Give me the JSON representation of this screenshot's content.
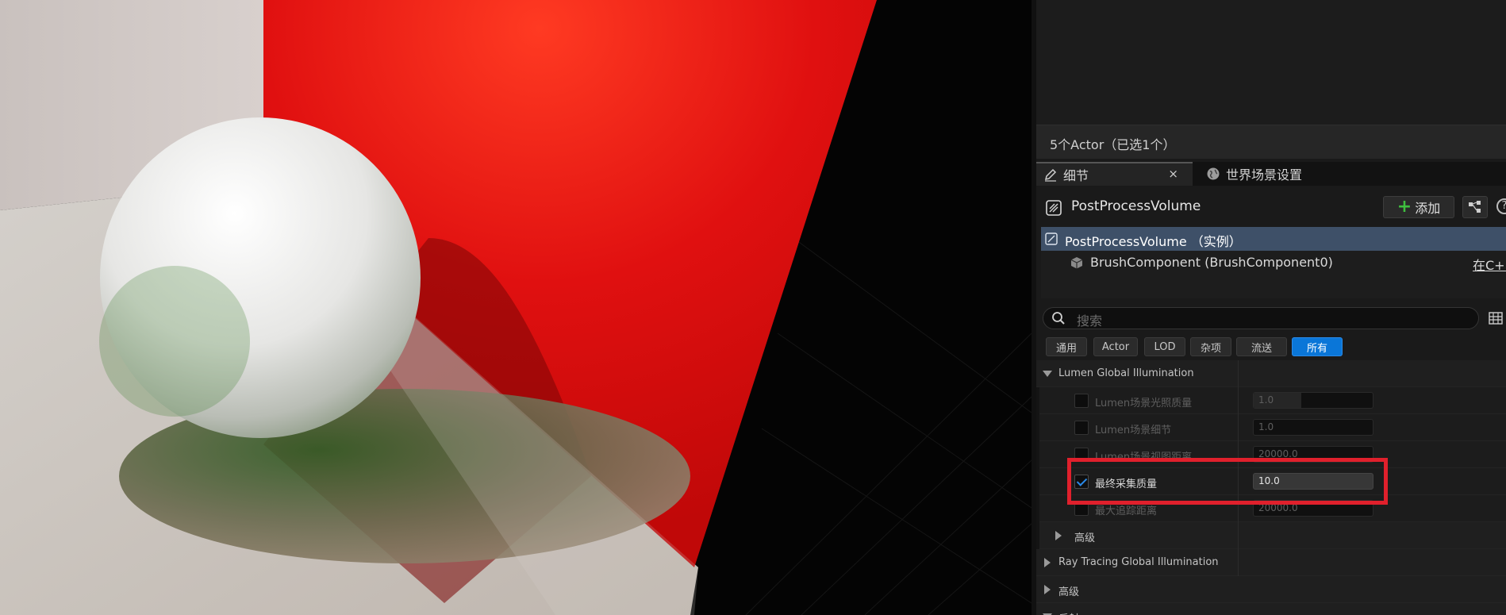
{
  "outliner": {
    "actor_count": "5个Actor（已选1个）"
  },
  "tabs": [
    {
      "label": "细节",
      "icon": "pencil-icon",
      "close": "×"
    },
    {
      "label": "世界场景设置",
      "icon": "globe-icon"
    }
  ],
  "details_header": {
    "title": "PostProcessVolume",
    "add_label": "添加",
    "add_icon": "plus-icon",
    "blueprint_icon": "blueprint-icon",
    "help_icon": "help-icon"
  },
  "components": [
    {
      "label": "PostProcessVolume （实例）",
      "selected": true
    },
    {
      "label": "BrushComponent (BrushComponent0)",
      "link": "在C++"
    }
  ],
  "search": {
    "placeholder": "搜索"
  },
  "filters": [
    "通用",
    "Actor",
    "LOD",
    "杂项",
    "流送",
    "所有"
  ],
  "active_filter": "所有",
  "sections": {
    "lumen_gi": "Lumen Global Illumination",
    "advanced_sub": "高级",
    "ray_tracing_gi": "Ray Tracing Global Illumination",
    "advanced": "高级",
    "reflection": "反射"
  },
  "properties": [
    {
      "label": "Lumen场景光照质量",
      "value": "1.0",
      "checked": false
    },
    {
      "label": "Lumen场景细节",
      "value": "1.0",
      "checked": false
    },
    {
      "label": "Lumen场景视图距离",
      "value": "20000.0",
      "checked": false
    },
    {
      "label": "最终采集质量",
      "value": "10.0",
      "checked": true
    },
    {
      "label": "最大追踪距离",
      "value": "20000.0",
      "checked": false
    }
  ],
  "colors": {
    "accent": "#0a76d8",
    "highlight_box": "#e0202c",
    "selected_row": "#3e5068"
  }
}
